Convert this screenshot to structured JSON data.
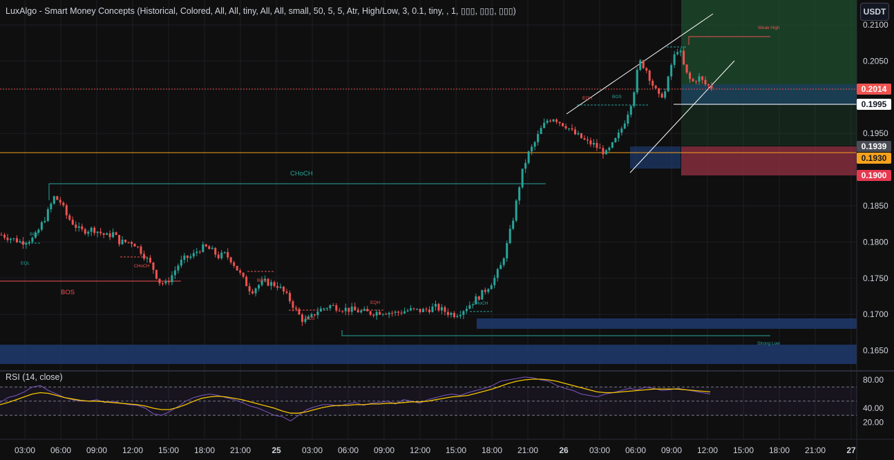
{
  "indicator": {
    "title": "LuxAlgo - Smart Money Concepts (Historical, Colored, All, All, tiny, All, All, small, 50, 5, 5, Atr, High/Low, 3, 0.1, tiny, , 1, ▯▯▯, ▯▯▯, ▯▯▯)"
  },
  "toolbar": {
    "currency": "USDT"
  },
  "price_tags": {
    "current": "0.2014",
    "white_line": "0.1995",
    "grey": "0.1939",
    "orange": "0.1930",
    "red": "0.1900"
  },
  "rsi": {
    "title": "RSI (14, close)"
  },
  "annotations": {
    "choch_main": "CHoCH",
    "bos_left": "BOS",
    "bos_small_1": "BOS",
    "eql_1": "EQL",
    "choch_small": "CHoCH",
    "bos_small_2": "BOS",
    "bos_small_3": "BOS",
    "eqh_1": "EQH",
    "choch_green": "CHoCH",
    "eqh_2": "EQH",
    "bos_top": "BOS",
    "weak_high": "Weak High",
    "strong_low": "Strong Low"
  },
  "colors": {
    "bull": "#26a69a",
    "bear": "#ef5350",
    "background": "#0f0f10",
    "grid": "#1e1f23",
    "axis_text": "#d1d4dc",
    "orange": "#f7a21b",
    "blue_zone": "#1e3a6e",
    "rsi_line": "#7e57c2",
    "rsi_ma": "#f7c600"
  },
  "chart_data": [
    {
      "type": "candlestick",
      "title": "",
      "price_ticks": [
        "0.2100",
        "0.2050",
        "0.1950",
        "0.1850",
        "0.1800",
        "0.1750",
        "0.1700",
        "0.1650"
      ],
      "time_ticks": [
        "03:00",
        "06:00",
        "09:00",
        "12:00",
        "15:00",
        "18:00",
        "21:00",
        "25",
        "03:00",
        "06:00",
        "09:00",
        "12:00",
        "15:00",
        "18:00",
        "21:00",
        "26",
        "03:00",
        "06:00",
        "09:00",
        "12:00",
        "15:00",
        "18:00",
        "21:00",
        "27"
      ],
      "ylim": [
        0.163,
        0.211
      ],
      "path": [
        [
          0,
          0.181
        ],
        [
          3,
          0.18
        ],
        [
          5,
          0.1805
        ],
        [
          7,
          0.184
        ],
        [
          8,
          0.1862
        ],
        [
          9,
          0.1855
        ],
        [
          10,
          0.1835
        ],
        [
          12,
          0.1815
        ],
        [
          14,
          0.1818
        ],
        [
          16,
          0.1808
        ],
        [
          17,
          0.1812
        ],
        [
          18,
          0.18
        ],
        [
          20,
          0.18
        ],
        [
          21,
          0.179
        ],
        [
          22,
          0.1778
        ],
        [
          23,
          0.1765
        ],
        [
          24,
          0.1745
        ],
        [
          25,
          0.1742
        ],
        [
          26,
          0.1755
        ],
        [
          27,
          0.177
        ],
        [
          28,
          0.1778
        ],
        [
          29,
          0.178
        ],
        [
          30,
          0.179
        ],
        [
          31,
          0.1793
        ],
        [
          32,
          0.1788
        ],
        [
          33,
          0.178
        ],
        [
          34,
          0.1783
        ],
        [
          35,
          0.1775
        ],
        [
          36,
          0.176
        ],
        [
          37,
          0.1745
        ],
        [
          38,
          0.1732
        ],
        [
          39,
          0.174
        ],
        [
          40,
          0.1745
        ],
        [
          42,
          0.174
        ],
        [
          43,
          0.173
        ],
        [
          44,
          0.1718
        ],
        [
          45,
          0.1702
        ],
        [
          46,
          0.169
        ],
        [
          47,
          0.1695
        ],
        [
          48,
          0.1705
        ],
        [
          50,
          0.1712
        ],
        [
          52,
          0.1708
        ],
        [
          54,
          0.1705
        ],
        [
          56,
          0.1702
        ],
        [
          58,
          0.1704
        ],
        [
          60,
          0.1702
        ],
        [
          62,
          0.1706
        ],
        [
          64,
          0.1705
        ],
        [
          66,
          0.171
        ],
        [
          68,
          0.1702
        ],
        [
          69,
          0.17
        ],
        [
          70,
          0.1705
        ],
        [
          71,
          0.1712
        ],
        [
          72,
          0.172
        ],
        [
          73,
          0.1728
        ],
        [
          74,
          0.1738
        ],
        [
          75,
          0.175
        ],
        [
          76,
          0.1768
        ],
        [
          77,
          0.18
        ],
        [
          78,
          0.184
        ],
        [
          79,
          0.189
        ],
        [
          80,
          0.192
        ],
        [
          81,
          0.1935
        ],
        [
          82,
          0.1955
        ],
        [
          83,
          0.1968
        ],
        [
          84,
          0.1972
        ],
        [
          85,
          0.1965
        ],
        [
          86,
          0.196
        ],
        [
          87,
          0.195
        ],
        [
          88,
          0.1945
        ],
        [
          89,
          0.1938
        ],
        [
          90,
          0.1935
        ],
        [
          91,
          0.1928
        ],
        [
          92,
          0.1922
        ],
        [
          93,
          0.1935
        ],
        [
          94,
          0.195
        ],
        [
          95,
          0.1972
        ],
        [
          96,
          0.2
        ],
        [
          97,
          0.205
        ],
        [
          98,
          0.204
        ],
        [
          99,
          0.2018
        ],
        [
          100,
          0.2
        ],
        [
          101,
          0.2008
        ],
        [
          102,
          0.205
        ],
        [
          103,
          0.207
        ],
        [
          104,
          0.2035
        ],
        [
          105,
          0.202
        ],
        [
          106,
          0.2028
        ],
        [
          107,
          0.2018
        ],
        [
          108,
          0.2014
        ]
      ],
      "volatility": 0.0006,
      "range_first_last": [
        0,
        108
      ]
    },
    {
      "type": "line",
      "title": "RSI (14, close)",
      "yticks": [
        "80.00",
        "40.00",
        "20.00"
      ],
      "ylim": [
        15,
        90
      ],
      "upper_band": 70,
      "lower_band": 30,
      "mid_band": 50,
      "series": [
        {
          "values": [
            48,
            55,
            58,
            63,
            70,
            72,
            65,
            60,
            55,
            52,
            50,
            50,
            52,
            48,
            50,
            47,
            45,
            44,
            40,
            32,
            30,
            35,
            42,
            50,
            55,
            58,
            60,
            58,
            55,
            52,
            48,
            43,
            40,
            35,
            30,
            28,
            22,
            30,
            38,
            42,
            45,
            45,
            43,
            46,
            48,
            44,
            47,
            48,
            50,
            46,
            52,
            50,
            47,
            52,
            55,
            58,
            60,
            58,
            62,
            65,
            68,
            72,
            78,
            80,
            82,
            84,
            83,
            80,
            78,
            72,
            68,
            65,
            60,
            58,
            56,
            60,
            62,
            65,
            68,
            66,
            70,
            68,
            65,
            66,
            68,
            66,
            64,
            62,
            60
          ]
        },
        {
          "values": [
            45,
            48,
            52,
            56,
            60,
            62,
            61,
            58,
            55,
            53,
            51,
            50,
            50,
            49,
            48,
            47,
            46,
            45,
            43,
            40,
            38,
            38,
            41,
            45,
            50,
            54,
            56,
            57,
            56,
            54,
            52,
            49,
            46,
            43,
            40,
            36,
            33,
            33,
            35,
            38,
            41,
            43,
            44,
            44,
            45,
            45,
            46,
            46,
            47,
            47,
            48,
            49,
            49,
            50,
            52,
            54,
            56,
            57,
            58,
            61,
            64,
            67,
            71,
            75,
            78,
            80,
            81,
            81,
            80,
            78,
            75,
            72,
            69,
            66,
            63,
            62,
            62,
            63,
            64,
            65,
            66,
            67,
            67,
            67,
            67,
            66,
            65,
            64,
            63
          ]
        }
      ]
    }
  ]
}
